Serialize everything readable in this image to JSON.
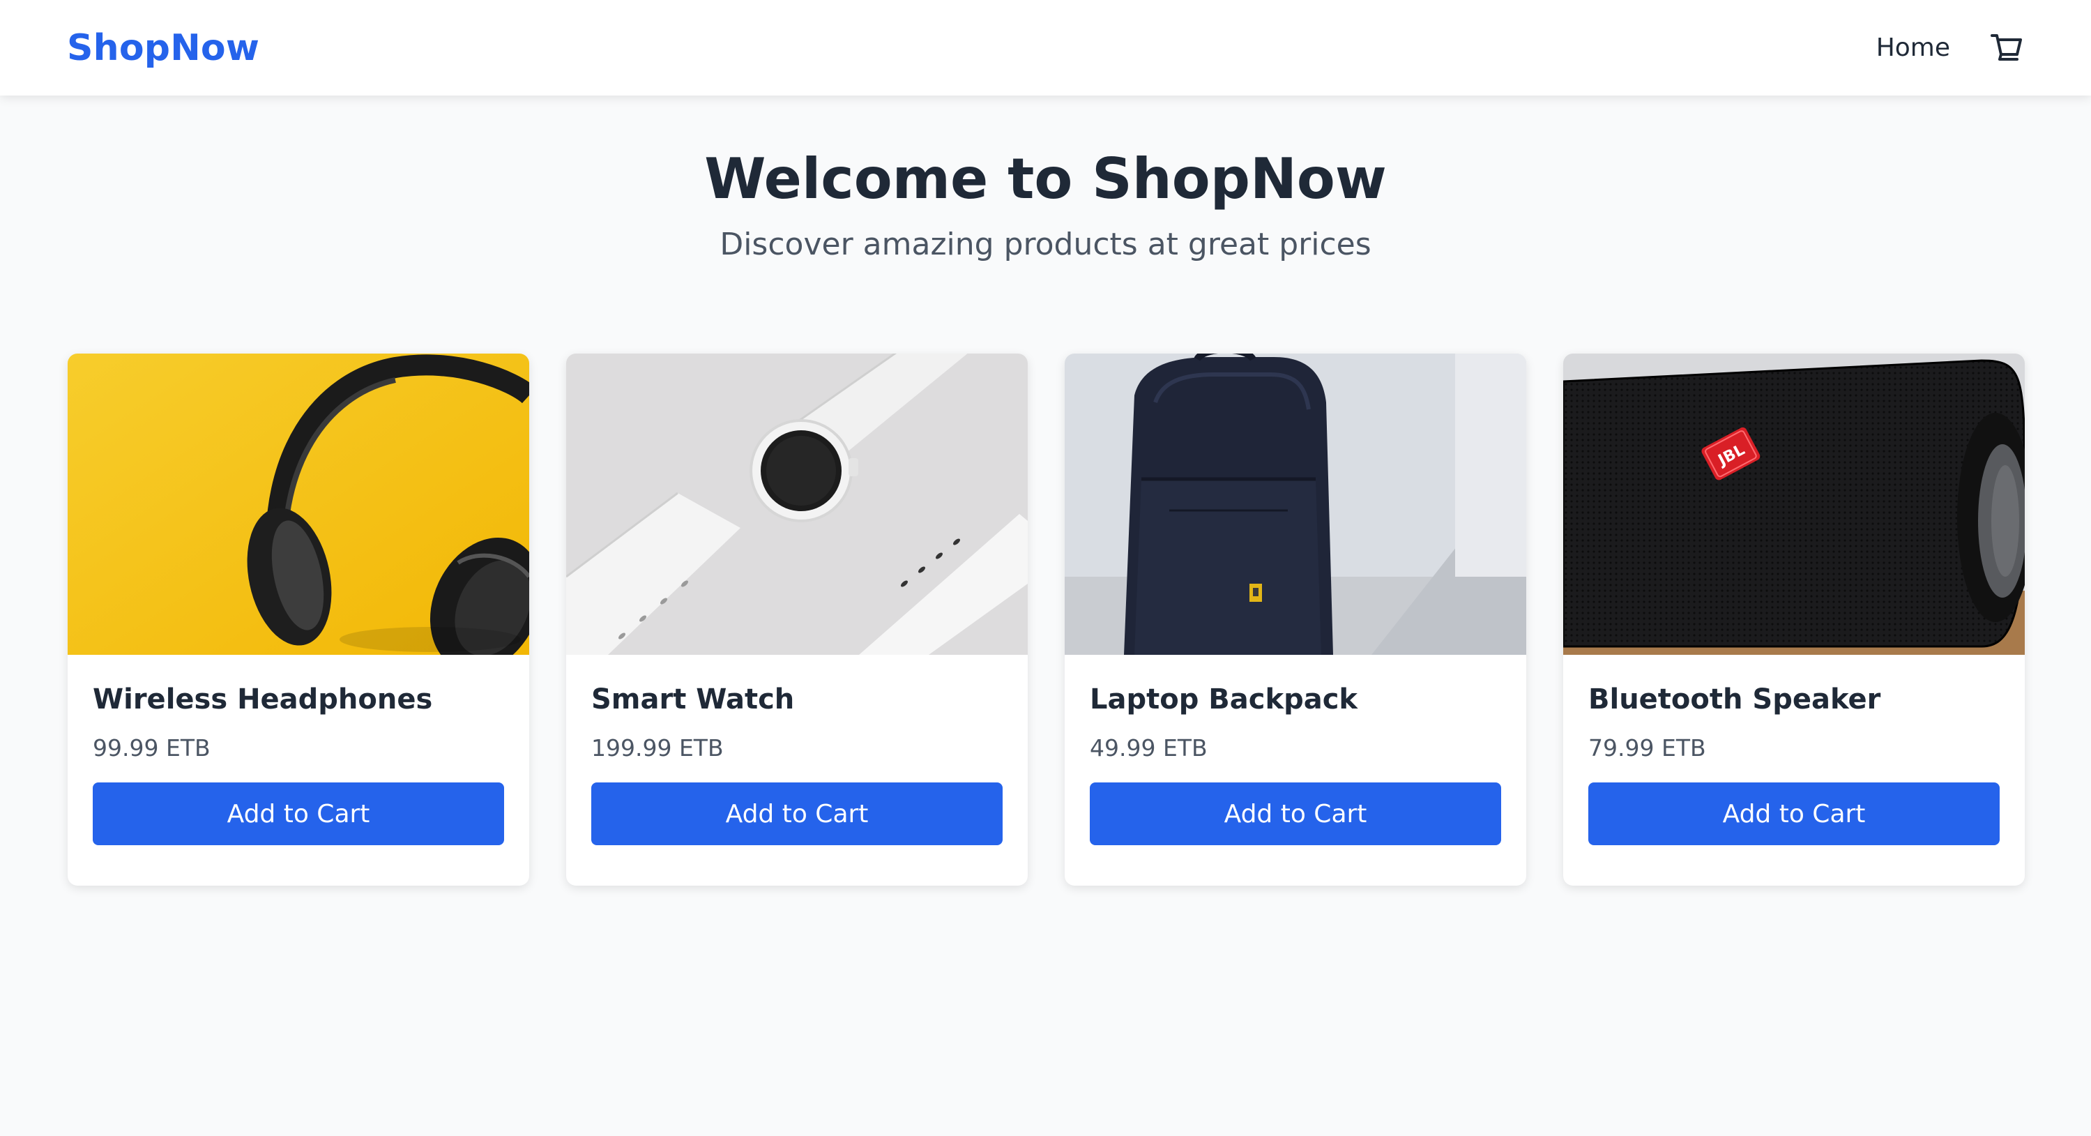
{
  "header": {
    "logo": "ShopNow",
    "nav_home": "Home",
    "cart_icon": "cart-icon"
  },
  "hero": {
    "title": "Welcome to ShopNow",
    "subtitle": "Discover amazing products at great prices"
  },
  "products": [
    {
      "name": "Wireless Headphones",
      "price": "99.99 ETB",
      "button": "Add to Cart",
      "image": "headphones-image"
    },
    {
      "name": "Smart Watch",
      "price": "199.99 ETB",
      "button": "Add to Cart",
      "image": "smartwatch-image"
    },
    {
      "name": "Laptop Backpack",
      "price": "49.99 ETB",
      "button": "Add to Cart",
      "image": "backpack-image"
    },
    {
      "name": "Bluetooth Speaker",
      "price": "79.99 ETB",
      "button": "Add to Cart",
      "image": "speaker-image"
    }
  ],
  "colors": {
    "brand": "#2563eb",
    "text_primary": "#1f2937",
    "text_secondary": "#4b5563",
    "background": "#f9fafb"
  }
}
